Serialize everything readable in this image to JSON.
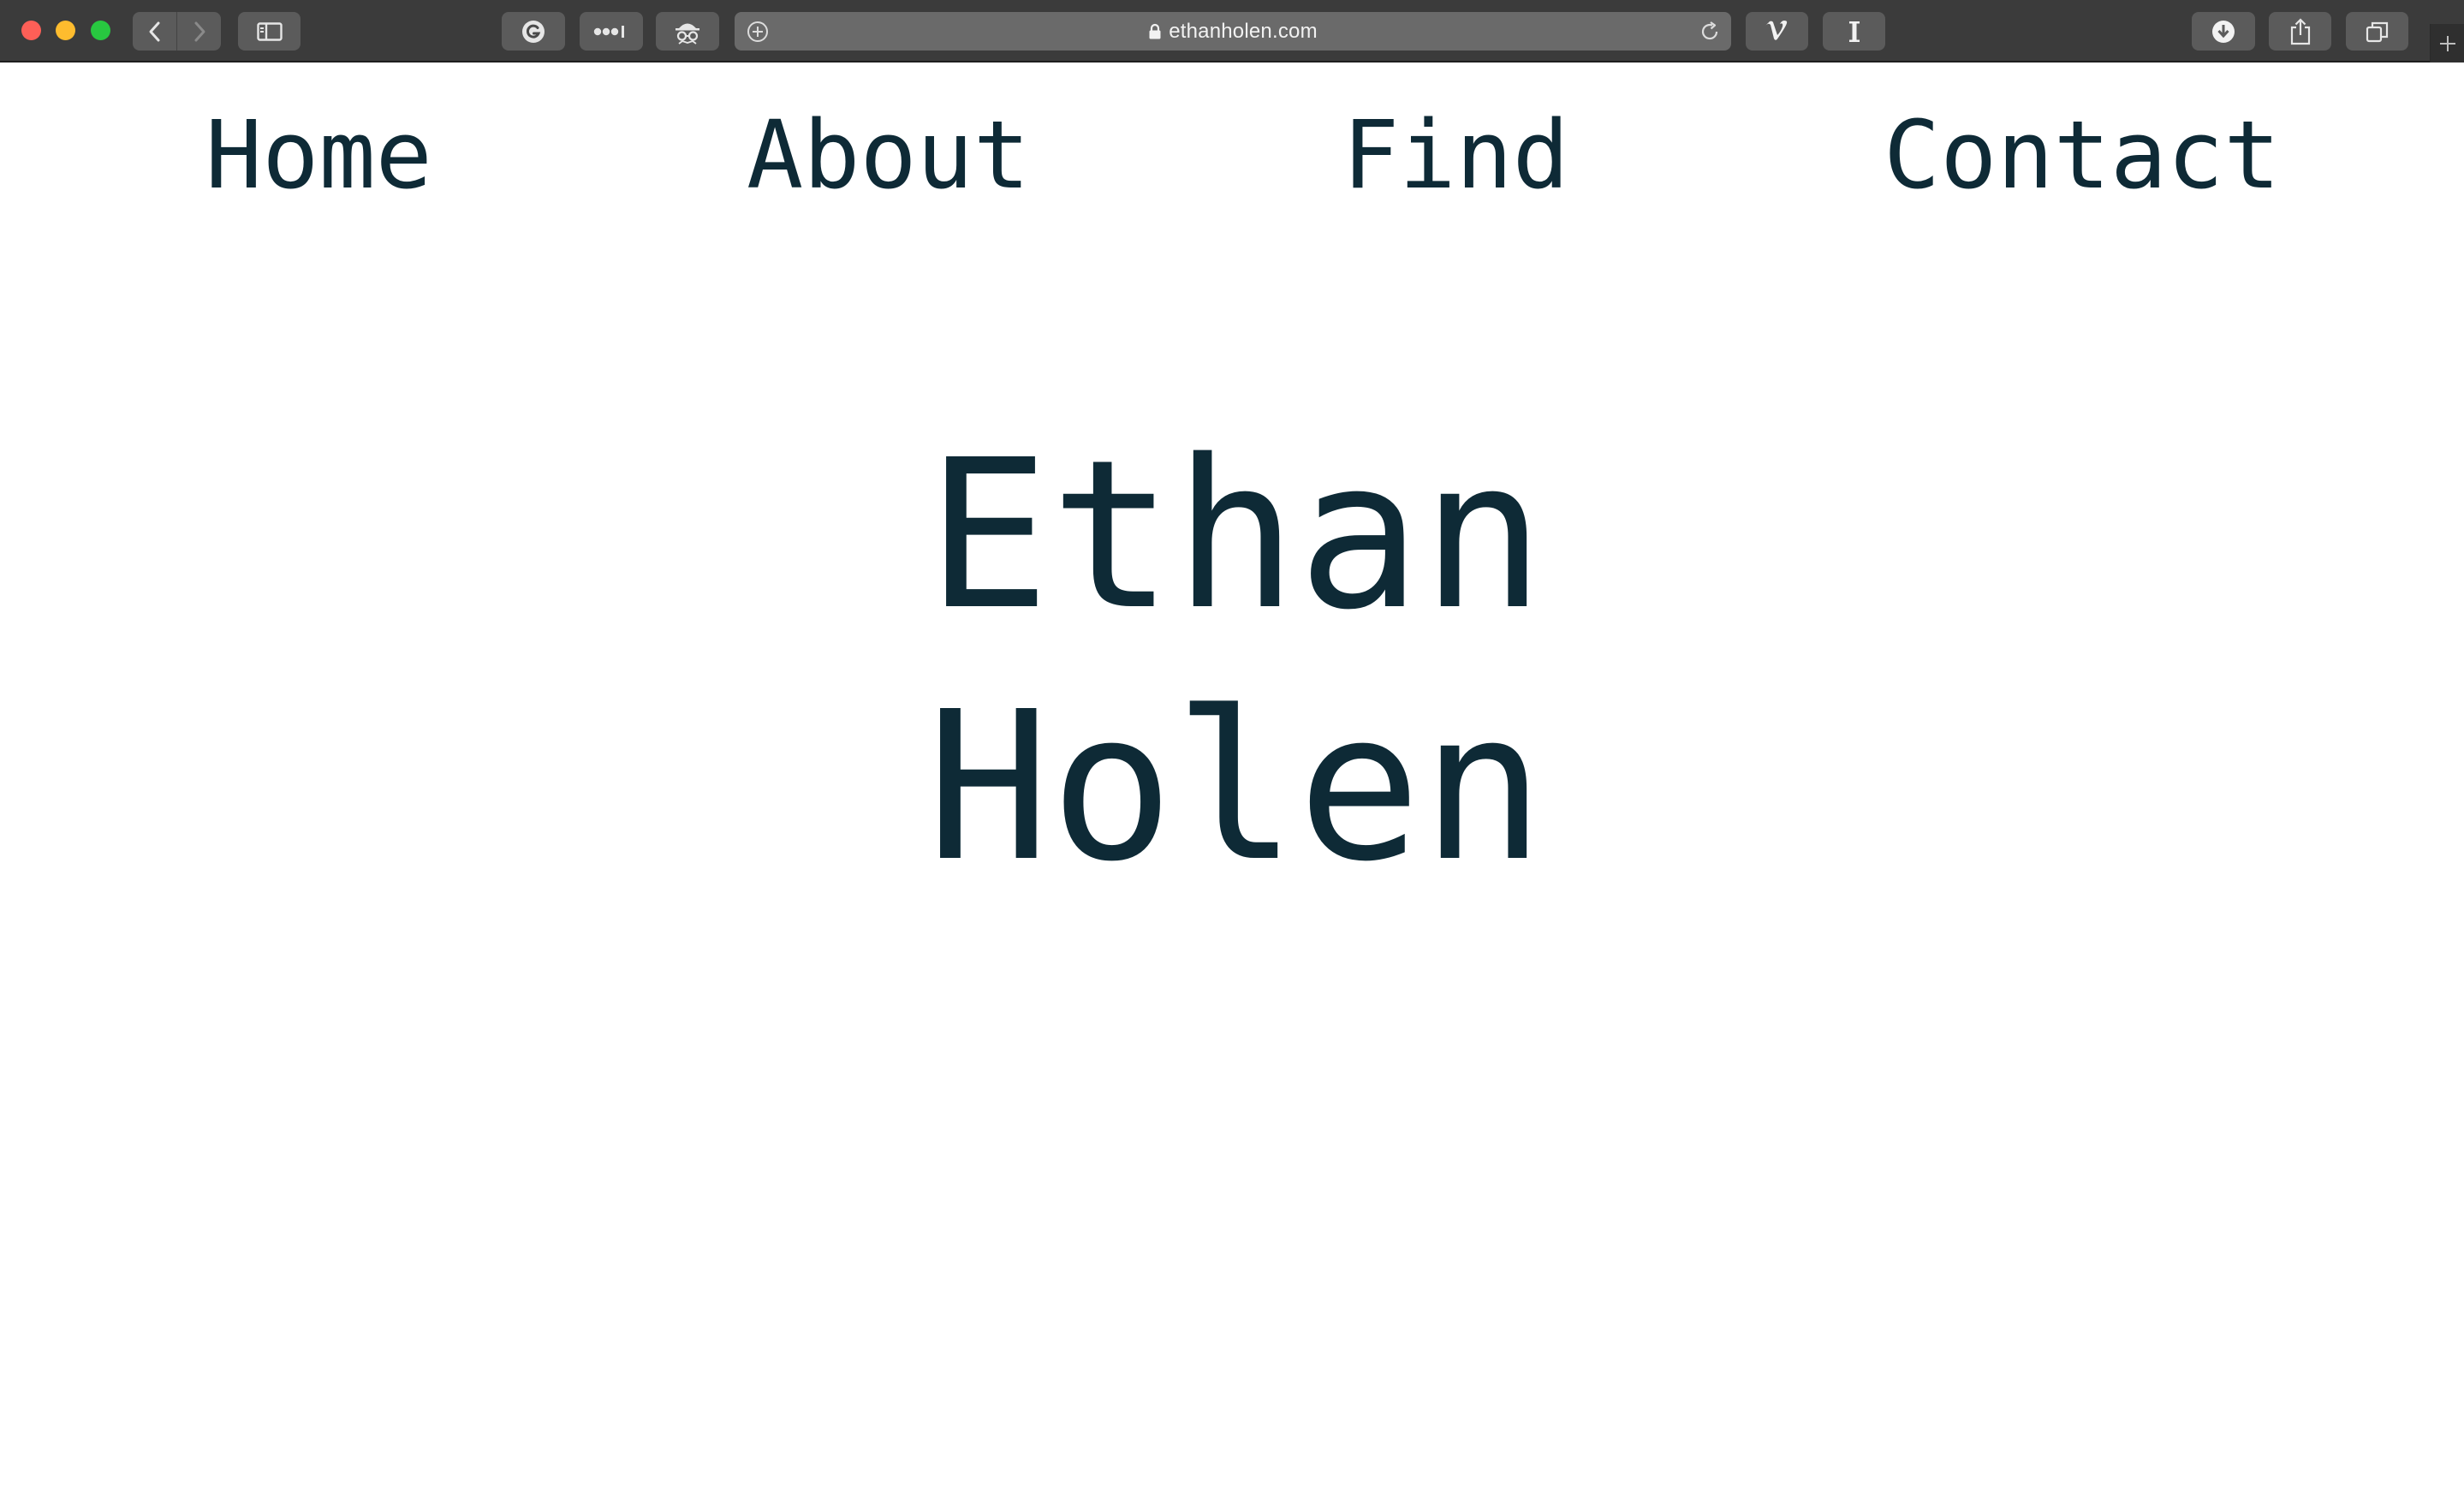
{
  "browser": {
    "url": "ethanholen.com",
    "toolbar_icons": [
      "back-icon",
      "forward-icon",
      "sidebar-icon",
      "grammarly-icon",
      "password-dots-icon",
      "incognito-icon",
      "add-icon",
      "lock-icon",
      "reload-icon",
      "vimeo-icon",
      "instapaper-icon",
      "download-icon",
      "share-icon",
      "tabs-overview-icon",
      "new-tab-icon"
    ]
  },
  "nav": {
    "home": "Home",
    "about": "About",
    "find": "Find",
    "contact": "Contact"
  },
  "hero": {
    "first_name": "Ethan",
    "last_name": "Holen"
  },
  "colors": {
    "text": "#0e2a36",
    "page_background": "#ffffff",
    "toolbar": "#3b3b3b"
  }
}
